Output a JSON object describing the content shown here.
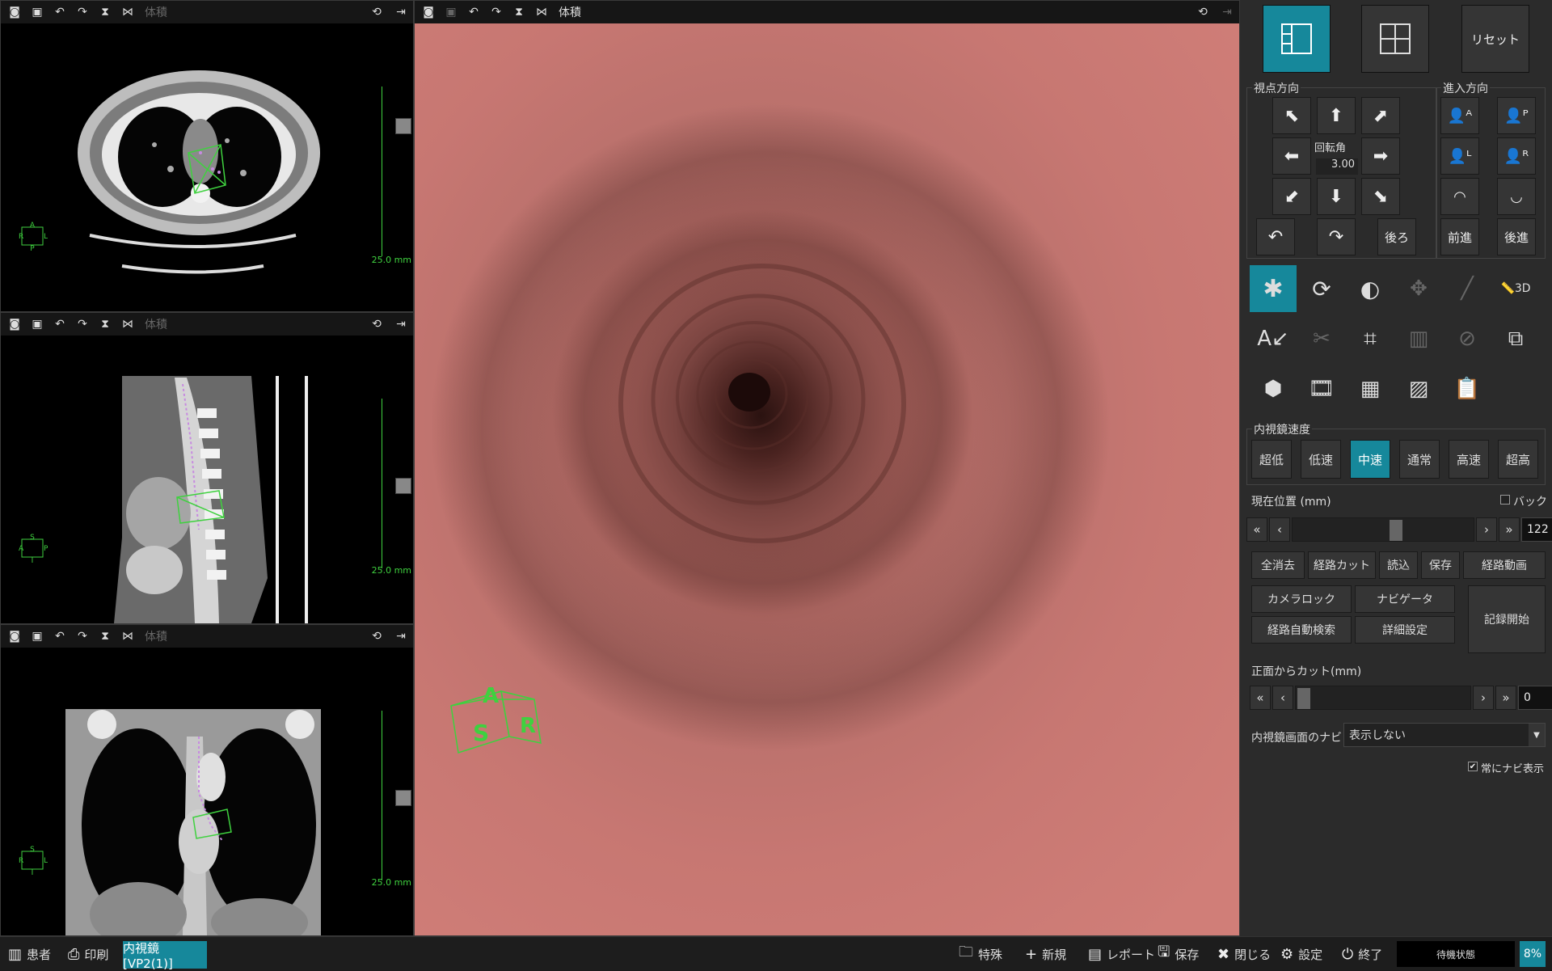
{
  "viewports": {
    "axial": {
      "title": "体積",
      "scale_label": "25.0 mm",
      "orientation": [
        "A",
        "R",
        "L",
        "P"
      ]
    },
    "sagittal": {
      "title": "体積",
      "scale_label": "25.0 mm",
      "orientation": [
        "S",
        "A",
        "P",
        "I"
      ]
    },
    "coronal": {
      "title": "体積",
      "scale_label": "25.0 mm",
      "orientation": [
        "S",
        "R",
        "L",
        "I"
      ]
    }
  },
  "main_view": {
    "title": "体積",
    "orientation_cube": {
      "top": "A",
      "front": "S",
      "side": "R"
    }
  },
  "layout_buttons": {
    "reset": "リセット"
  },
  "view_direction": {
    "label": "視点方向",
    "rotation_label": "回転角",
    "rotation_value": "3.00",
    "back": "後ろ"
  },
  "entry_direction": {
    "label": "進入方向",
    "forward": "前進",
    "backward": "後進"
  },
  "endoscope_speed": {
    "label": "内視鏡速度",
    "options": [
      "超低",
      "低速",
      "中速",
      "通常",
      "高速",
      "超高"
    ],
    "selected": "中速"
  },
  "current_position": {
    "label": "現在位置 (mm)",
    "back_checkbox": "バック",
    "value": "122",
    "slider_fraction": 0.58
  },
  "actions": {
    "clear_all": "全消去",
    "path_cut": "経路カット",
    "load": "読込",
    "save": "保存",
    "path_movie": "経路動画",
    "camera_lock": "カメラロック",
    "navigator": "ナビゲータ",
    "auto_path_search": "経路自動検索",
    "detail_settings": "詳細設定",
    "start_recording": "記録開始"
  },
  "front_cut": {
    "label": "正面からカット(mm)",
    "value": "0",
    "slider_fraction": 0.0
  },
  "navi": {
    "label": "内視鏡画面のナビ",
    "selected": "表示しない",
    "always_show": "常にナビ表示",
    "always_show_checked": true
  },
  "statusbar": {
    "patient": "患者",
    "print": "印刷",
    "active_tab": "内視鏡[VP2(1)]",
    "special": "特殊",
    "new": "新規",
    "report": "レポート",
    "save": "保存",
    "close": "閉じる",
    "settings": "設定",
    "exit": "終了",
    "status": "待機状態",
    "progress": "8%"
  },
  "colors": {
    "accent": "#16889b",
    "overlay_green": "#3fd13f",
    "lumen": "#c67470"
  }
}
